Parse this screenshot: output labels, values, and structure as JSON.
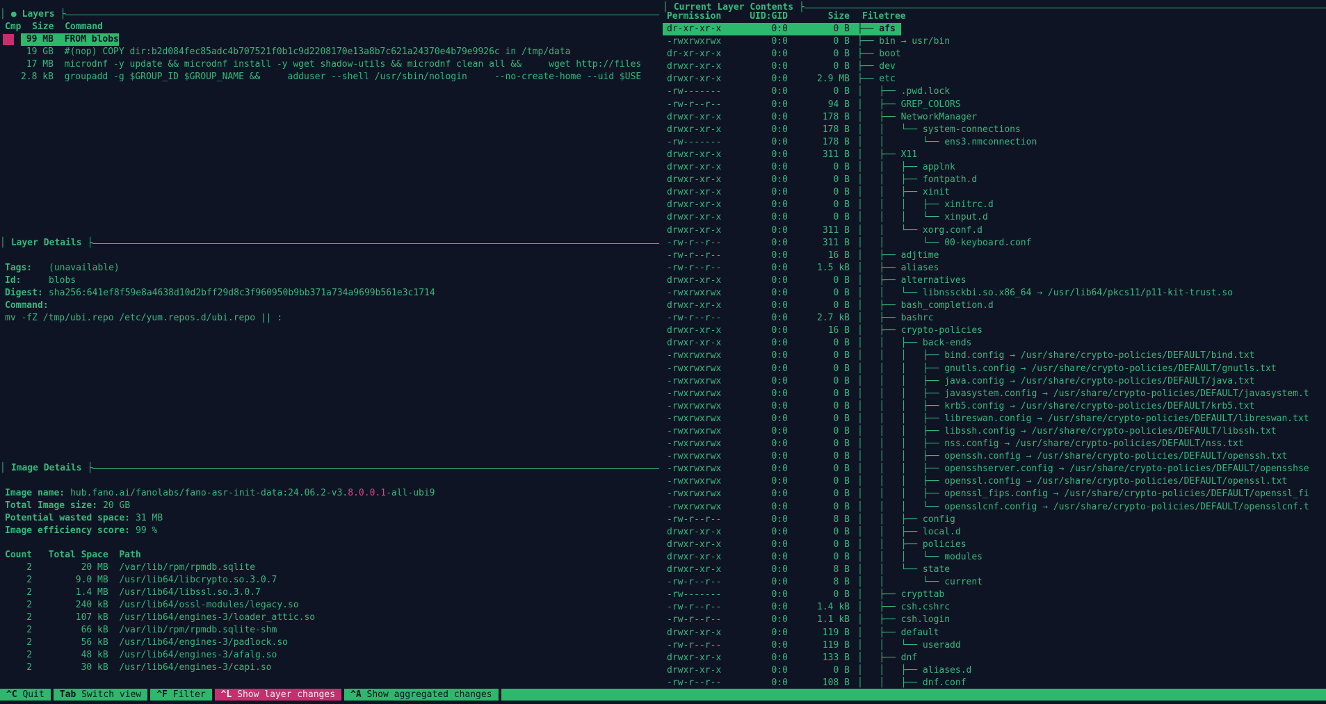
{
  "colors": {
    "background": "#0f1424",
    "green_text": "#36b97c",
    "highlight_green": "#2cb96d",
    "magenta": "#c62f6e",
    "pink_text": "#d2498c"
  },
  "layers_panel": {
    "active_indicator": "●",
    "title": "Layers",
    "columns": [
      "Cmp",
      "Size",
      "Command"
    ],
    "rows": [
      {
        "size": "99 MB",
        "command": "FROM blobs",
        "selected": true,
        "cmp_color": "#c62f6e"
      },
      {
        "size": "19 GB",
        "command": "#(nop) COPY dir:b2d084fec85adc4b707521f0b1c9d2208170e13a8b7c621a24370e4b79e9926c in /tmp/data"
      },
      {
        "size": "17 MB",
        "command": "microdnf -y update && microdnf install -y wget shadow-utils && microdnf clean all &&     wget http://files"
      },
      {
        "size": "2.8 kB",
        "command": "groupadd -g $GROUP_ID $GROUP_NAME &&     adduser --shell /usr/sbin/nologin     --no-create-home --uid $USE"
      }
    ]
  },
  "layer_details": {
    "title": "Layer Details",
    "tags_label": "Tags:",
    "tags_value": "(unavailable)",
    "id_label": "Id:",
    "id_value": "blobs",
    "digest_label": "Digest:",
    "digest_value": "sha256:641ef8f59e8a4638d10d2bff29d8c3f960950b9bb371a734a9699b561e3c1714",
    "command_label": "Command:",
    "command_value": "mv -fZ /tmp/ubi.repo /etc/yum.repos.d/ubi.repo || :"
  },
  "image_details": {
    "title": "Image Details",
    "name_label": "Image name:",
    "name_pre": "hub.fano.ai/fanolabs/fano-asr-init-data:24.06.2-v3.",
    "name_highlight": "8.0.0.1",
    "name_post": "-all-ubi9",
    "size_label": "Total Image size:",
    "size_value": "20 GB",
    "wasted_label": "Potential wasted space:",
    "wasted_value": "31 MB",
    "efficiency_label": "Image efficiency score:",
    "efficiency_value": "99 %"
  },
  "duplicates_table": {
    "columns": [
      "Count",
      "Total Space",
      "Path"
    ],
    "rows": [
      {
        "count": "2",
        "total_space": "20 MB",
        "path": "/var/lib/rpm/rpmdb.sqlite"
      },
      {
        "count": "2",
        "total_space": "9.0 MB",
        "path": "/usr/lib64/libcrypto.so.3.0.7"
      },
      {
        "count": "2",
        "total_space": "1.4 MB",
        "path": "/usr/lib64/libssl.so.3.0.7"
      },
      {
        "count": "2",
        "total_space": "240 kB",
        "path": "/usr/lib64/ossl-modules/legacy.so"
      },
      {
        "count": "2",
        "total_space": "107 kB",
        "path": "/usr/lib64/engines-3/loader_attic.so"
      },
      {
        "count": "2",
        "total_space": "66 kB",
        "path": "/var/lib/rpm/rpmdb.sqlite-shm"
      },
      {
        "count": "2",
        "total_space": "56 kB",
        "path": "/usr/lib64/engines-3/padlock.so"
      },
      {
        "count": "2",
        "total_space": "48 kB",
        "path": "/usr/lib64/engines-3/afalg.so"
      },
      {
        "count": "2",
        "total_space": "30 kB",
        "path": "/usr/lib64/engines-3/capi.so"
      }
    ]
  },
  "contents_panel": {
    "title": "Current Layer Contents",
    "columns": [
      "Permission",
      "UID:GID",
      "Size",
      "Filetree"
    ],
    "rows": [
      {
        "permission": "dr-xr-xr-x",
        "uid_gid": "0:0",
        "size": "0 B",
        "tree_prefix": "├── ",
        "name": "afs",
        "selected": true
      },
      {
        "permission": "-rwxrwxrwx",
        "uid_gid": "0:0",
        "size": "0 B",
        "tree_prefix": "├── ",
        "name": "bin → usr/bin"
      },
      {
        "permission": "dr-xr-xr-x",
        "uid_gid": "0:0",
        "size": "0 B",
        "tree_prefix": "├── ",
        "name": "boot"
      },
      {
        "permission": "drwxr-xr-x",
        "uid_gid": "0:0",
        "size": "0 B",
        "tree_prefix": "├── ",
        "name": "dev"
      },
      {
        "permission": "drwxr-xr-x",
        "uid_gid": "0:0",
        "size": "2.9 MB",
        "tree_prefix": "├── ",
        "name": "etc"
      },
      {
        "permission": "-rw-------",
        "uid_gid": "0:0",
        "size": "0 B",
        "tree_prefix": "│   ├── ",
        "name": ".pwd.lock"
      },
      {
        "permission": "-rw-r--r--",
        "uid_gid": "0:0",
        "size": "94 B",
        "tree_prefix": "│   ├── ",
        "name": "GREP_COLORS"
      },
      {
        "permission": "drwxr-xr-x",
        "uid_gid": "0:0",
        "size": "178 B",
        "tree_prefix": "│   ├── ",
        "name": "NetworkManager"
      },
      {
        "permission": "drwxr-xr-x",
        "uid_gid": "0:0",
        "size": "178 B",
        "tree_prefix": "│   │   └── ",
        "name": "system-connections"
      },
      {
        "permission": "-rw-------",
        "uid_gid": "0:0",
        "size": "178 B",
        "tree_prefix": "│   │       └── ",
        "name": "ens3.nmconnection"
      },
      {
        "permission": "drwxr-xr-x",
        "uid_gid": "0:0",
        "size": "311 B",
        "tree_prefix": "│   ├── ",
        "name": "X11"
      },
      {
        "permission": "drwxr-xr-x",
        "uid_gid": "0:0",
        "size": "0 B",
        "tree_prefix": "│   │   ├── ",
        "name": "applnk"
      },
      {
        "permission": "drwxr-xr-x",
        "uid_gid": "0:0",
        "size": "0 B",
        "tree_prefix": "│   │   ├── ",
        "name": "fontpath.d"
      },
      {
        "permission": "drwxr-xr-x",
        "uid_gid": "0:0",
        "size": "0 B",
        "tree_prefix": "│   │   ├── ",
        "name": "xinit"
      },
      {
        "permission": "drwxr-xr-x",
        "uid_gid": "0:0",
        "size": "0 B",
        "tree_prefix": "│   │   │   ├── ",
        "name": "xinitrc.d"
      },
      {
        "permission": "drwxr-xr-x",
        "uid_gid": "0:0",
        "size": "0 B",
        "tree_prefix": "│   │   │   └── ",
        "name": "xinput.d"
      },
      {
        "permission": "drwxr-xr-x",
        "uid_gid": "0:0",
        "size": "311 B",
        "tree_prefix": "│   │   └── ",
        "name": "xorg.conf.d"
      },
      {
        "permission": "-rw-r--r--",
        "uid_gid": "0:0",
        "size": "311 B",
        "tree_prefix": "│   │       └── ",
        "name": "00-keyboard.conf"
      },
      {
        "permission": "-rw-r--r--",
        "uid_gid": "0:0",
        "size": "16 B",
        "tree_prefix": "│   ├── ",
        "name": "adjtime"
      },
      {
        "permission": "-rw-r--r--",
        "uid_gid": "0:0",
        "size": "1.5 kB",
        "tree_prefix": "│   ├── ",
        "name": "aliases"
      },
      {
        "permission": "drwxr-xr-x",
        "uid_gid": "0:0",
        "size": "0 B",
        "tree_prefix": "│   ├── ",
        "name": "alternatives"
      },
      {
        "permission": "-rwxrwxrwx",
        "uid_gid": "0:0",
        "size": "0 B",
        "tree_prefix": "│   │   └── ",
        "name": "libnssckbi.so.x86_64 → /usr/lib64/pkcs11/p11-kit-trust.so"
      },
      {
        "permission": "drwxr-xr-x",
        "uid_gid": "0:0",
        "size": "0 B",
        "tree_prefix": "│   ├── ",
        "name": "bash_completion.d"
      },
      {
        "permission": "-rw-r--r--",
        "uid_gid": "0:0",
        "size": "2.7 kB",
        "tree_prefix": "│   ├── ",
        "name": "bashrc"
      },
      {
        "permission": "drwxr-xr-x",
        "uid_gid": "0:0",
        "size": "16 B",
        "tree_prefix": "│   ├── ",
        "name": "crypto-policies"
      },
      {
        "permission": "drwxr-xr-x",
        "uid_gid": "0:0",
        "size": "0 B",
        "tree_prefix": "│   │   ├── ",
        "name": "back-ends"
      },
      {
        "permission": "-rwxrwxrwx",
        "uid_gid": "0:0",
        "size": "0 B",
        "tree_prefix": "│   │   │   ├── ",
        "name": "bind.config → /usr/share/crypto-policies/DEFAULT/bind.txt"
      },
      {
        "permission": "-rwxrwxrwx",
        "uid_gid": "0:0",
        "size": "0 B",
        "tree_prefix": "│   │   │   ├── ",
        "name": "gnutls.config → /usr/share/crypto-policies/DEFAULT/gnutls.txt"
      },
      {
        "permission": "-rwxrwxrwx",
        "uid_gid": "0:0",
        "size": "0 B",
        "tree_prefix": "│   │   │   ├── ",
        "name": "java.config → /usr/share/crypto-policies/DEFAULT/java.txt"
      },
      {
        "permission": "-rwxrwxrwx",
        "uid_gid": "0:0",
        "size": "0 B",
        "tree_prefix": "│   │   │   ├── ",
        "name": "javasystem.config → /usr/share/crypto-policies/DEFAULT/javasystem.t"
      },
      {
        "permission": "-rwxrwxrwx",
        "uid_gid": "0:0",
        "size": "0 B",
        "tree_prefix": "│   │   │   ├── ",
        "name": "krb5.config → /usr/share/crypto-policies/DEFAULT/krb5.txt"
      },
      {
        "permission": "-rwxrwxrwx",
        "uid_gid": "0:0",
        "size": "0 B",
        "tree_prefix": "│   │   │   ├── ",
        "name": "libreswan.config → /usr/share/crypto-policies/DEFAULT/libreswan.txt"
      },
      {
        "permission": "-rwxrwxrwx",
        "uid_gid": "0:0",
        "size": "0 B",
        "tree_prefix": "│   │   │   ├── ",
        "name": "libssh.config → /usr/share/crypto-policies/DEFAULT/libssh.txt"
      },
      {
        "permission": "-rwxrwxrwx",
        "uid_gid": "0:0",
        "size": "0 B",
        "tree_prefix": "│   │   │   ├── ",
        "name": "nss.config → /usr/share/crypto-policies/DEFAULT/nss.txt"
      },
      {
        "permission": "-rwxrwxrwx",
        "uid_gid": "0:0",
        "size": "0 B",
        "tree_prefix": "│   │   │   ├── ",
        "name": "openssh.config → /usr/share/crypto-policies/DEFAULT/openssh.txt"
      },
      {
        "permission": "-rwxrwxrwx",
        "uid_gid": "0:0",
        "size": "0 B",
        "tree_prefix": "│   │   │   ├── ",
        "name": "opensshserver.config → /usr/share/crypto-policies/DEFAULT/opensshse"
      },
      {
        "permission": "-rwxrwxrwx",
        "uid_gid": "0:0",
        "size": "0 B",
        "tree_prefix": "│   │   │   ├── ",
        "name": "openssl.config → /usr/share/crypto-policies/DEFAULT/openssl.txt"
      },
      {
        "permission": "-rwxrwxrwx",
        "uid_gid": "0:0",
        "size": "0 B",
        "tree_prefix": "│   │   │   ├── ",
        "name": "openssl_fips.config → /usr/share/crypto-policies/DEFAULT/openssl_fi"
      },
      {
        "permission": "-rwxrwxrwx",
        "uid_gid": "0:0",
        "size": "0 B",
        "tree_prefix": "│   │   │   └── ",
        "name": "opensslcnf.config → /usr/share/crypto-policies/DEFAULT/opensslcnf.t"
      },
      {
        "permission": "-rw-r--r--",
        "uid_gid": "0:0",
        "size": "8 B",
        "tree_prefix": "│   │   ├── ",
        "name": "config"
      },
      {
        "permission": "drwxr-xr-x",
        "uid_gid": "0:0",
        "size": "0 B",
        "tree_prefix": "│   │   ├── ",
        "name": "local.d"
      },
      {
        "permission": "drwxr-xr-x",
        "uid_gid": "0:0",
        "size": "0 B",
        "tree_prefix": "│   │   ├── ",
        "name": "policies"
      },
      {
        "permission": "drwxr-xr-x",
        "uid_gid": "0:0",
        "size": "0 B",
        "tree_prefix": "│   │   │   └── ",
        "name": "modules"
      },
      {
        "permission": "drwxr-xr-x",
        "uid_gid": "0:0",
        "size": "8 B",
        "tree_prefix": "│   │   └── ",
        "name": "state"
      },
      {
        "permission": "-rw-r--r--",
        "uid_gid": "0:0",
        "size": "8 B",
        "tree_prefix": "│   │       └── ",
        "name": "current"
      },
      {
        "permission": "-rw-------",
        "uid_gid": "0:0",
        "size": "0 B",
        "tree_prefix": "│   ├── ",
        "name": "crypttab"
      },
      {
        "permission": "-rw-r--r--",
        "uid_gid": "0:0",
        "size": "1.4 kB",
        "tree_prefix": "│   ├── ",
        "name": "csh.cshrc"
      },
      {
        "permission": "-rw-r--r--",
        "uid_gid": "0:0",
        "size": "1.1 kB",
        "tree_prefix": "│   ├── ",
        "name": "csh.login"
      },
      {
        "permission": "drwxr-xr-x",
        "uid_gid": "0:0",
        "size": "119 B",
        "tree_prefix": "│   ├── ",
        "name": "default"
      },
      {
        "permission": "-rw-r--r--",
        "uid_gid": "0:0",
        "size": "119 B",
        "tree_prefix": "│   │   └── ",
        "name": "useradd"
      },
      {
        "permission": "drwxr-xr-x",
        "uid_gid": "0:0",
        "size": "133 B",
        "tree_prefix": "│   ├── ",
        "name": "dnf"
      },
      {
        "permission": "drwxr-xr-x",
        "uid_gid": "0:0",
        "size": "0 B",
        "tree_prefix": "│   │   ├── ",
        "name": "aliases.d"
      },
      {
        "permission": "-rw-r--r--",
        "uid_gid": "0:0",
        "size": "108 B",
        "tree_prefix": "│   │   ├── ",
        "name": "dnf.conf"
      }
    ]
  },
  "status_bar": {
    "items": [
      {
        "key": "^C",
        "label": "Quit",
        "variant": "green"
      },
      {
        "key": "Tab",
        "label": "Switch view",
        "variant": "green"
      },
      {
        "key": "^F",
        "label": "Filter",
        "variant": "green"
      },
      {
        "key": "^L",
        "label": "Show layer changes",
        "variant": "magenta"
      },
      {
        "key": "^A",
        "label": "Show aggregated changes",
        "variant": "green"
      }
    ]
  }
}
